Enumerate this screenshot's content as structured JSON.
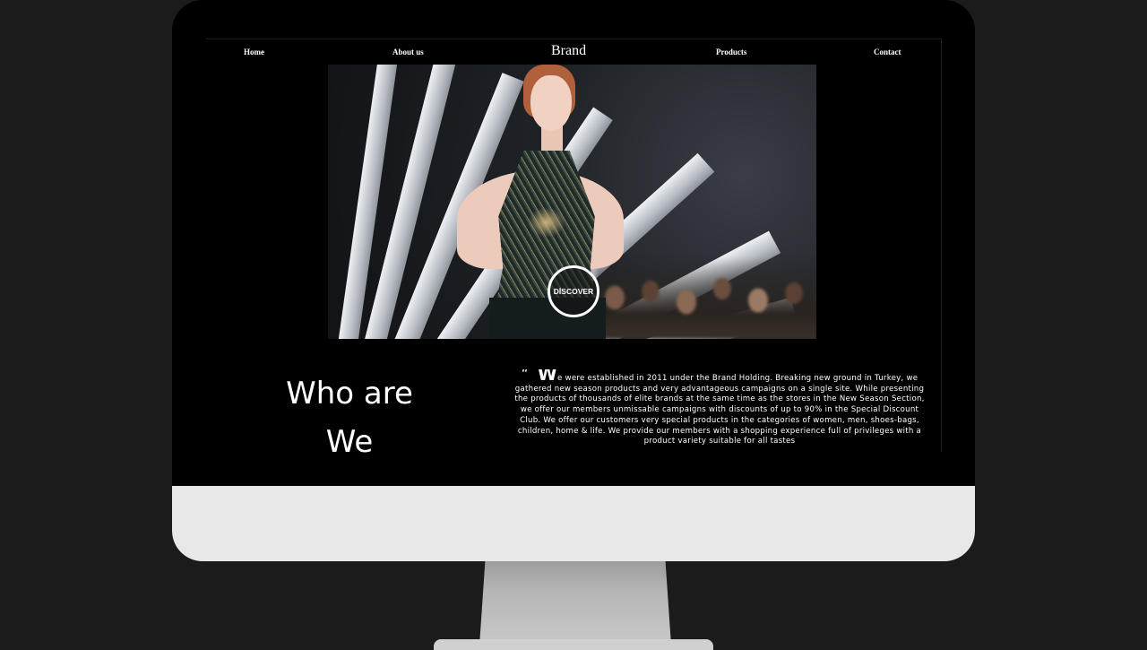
{
  "nav": {
    "home": "Home",
    "about": "About us",
    "brand": "Brand",
    "products": "Products",
    "contact": "Contact"
  },
  "hero": {
    "discover_label": "DİSCOVER"
  },
  "about_section": {
    "title_line1": "Who are",
    "title_line2": "We",
    "quote_mark": "“",
    "drop_cap": "W",
    "body": "e were established in 2011 under the Brand Holding. Breaking new ground in Turkey, we gathered new season products and very advantageous campaigns on a single site. While presenting the products of thousands of elite brands at the same time as the stores in the New Season Section, we offer our members unmissable campaigns with discounts of up to 90% in the Special Discount Club. We offer our customers very special products in the categories of women, men, shoes-bags, children, home & life. We provide our members with a shopping experience full of privileges with a product variety suitable for all tastes"
  },
  "colors": {
    "page_background": "#1b1b1b",
    "monitor_bezel": "#000000",
    "monitor_chin": "#e8e8e8",
    "text": "#ffffff"
  }
}
